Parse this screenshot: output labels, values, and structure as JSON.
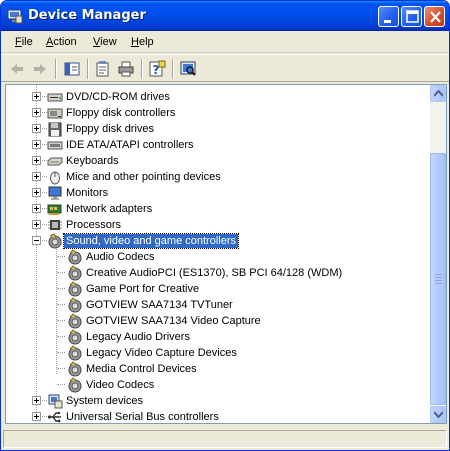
{
  "window": {
    "title": "Device Manager"
  },
  "menu": {
    "items": [
      {
        "label": "File",
        "u": "F",
        "rest": "ile"
      },
      {
        "label": "Action",
        "u": "A",
        "rest": "ction"
      },
      {
        "label": "View",
        "u": "V",
        "rest": "iew"
      },
      {
        "label": "Help",
        "u": "H",
        "rest": "elp"
      }
    ]
  },
  "toolbar": {
    "icons": [
      "back-arrow-icon",
      "forward-arrow-icon",
      "console-tree-icon",
      "properties-icon",
      "print-icon",
      "help-icon",
      "scan-hardware-icon"
    ]
  },
  "tree": {
    "categories_top": [
      {
        "label": "DVD/CD-ROM drives",
        "icon": "dvd-drive-icon"
      },
      {
        "label": "Floppy disk controllers",
        "icon": "floppy-controller-icon"
      },
      {
        "label": "Floppy disk drives",
        "icon": "floppy-drive-icon"
      },
      {
        "label": "IDE ATA/ATAPI controllers",
        "icon": "ide-controller-icon"
      },
      {
        "label": "Keyboards",
        "icon": "keyboard-icon"
      },
      {
        "label": "Mice and other pointing devices",
        "icon": "mouse-icon"
      },
      {
        "label": "Monitors",
        "icon": "monitor-icon"
      },
      {
        "label": "Network adapters",
        "icon": "network-adapter-icon"
      },
      {
        "label": "Processors",
        "icon": "processor-icon"
      }
    ],
    "expanded": {
      "label": "Sound, video and game controllers",
      "icon": "sound-icon"
    },
    "children": [
      "Audio Codecs",
      "Creative AudioPCI (ES1370), SB PCI 64/128 (WDM)",
      "Game Port for Creative",
      "GOTVIEW SAA7134 TVTuner",
      "GOTVIEW SAA7134 Video Capture",
      "Legacy Audio Drivers",
      "Legacy Video Capture Devices",
      "Media Control Devices",
      "Video Codecs"
    ],
    "categories_bottom": [
      {
        "label": "System devices",
        "icon": "system-devices-icon"
      },
      {
        "label": "Universal Serial Bus controllers",
        "icon": "usb-icon"
      }
    ]
  },
  "colors": {
    "selection": "#316ac5",
    "titlebar": "#0053ee"
  }
}
